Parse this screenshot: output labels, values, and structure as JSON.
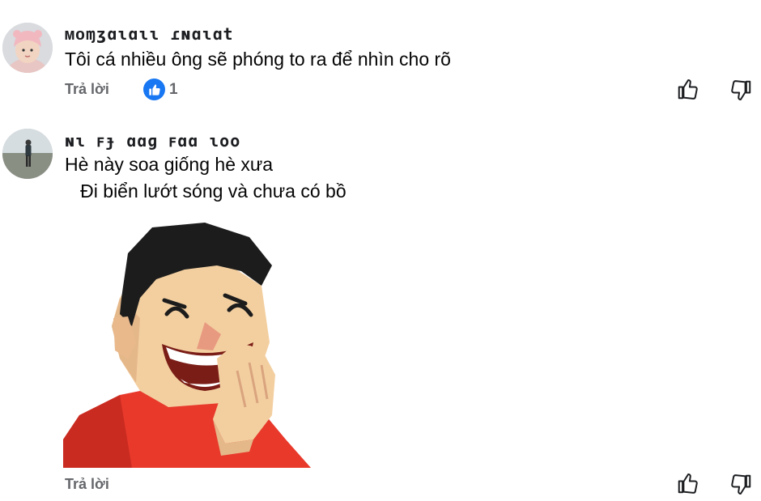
{
  "comments": [
    {
      "author": "ᴍᴏɱʒɑɩɑɩɩ ɾɴɑɩɑt",
      "text": "Tôi cá nhiều ông sẽ phóng to ra để nhìn cho rõ",
      "reply_label": "Trả lời",
      "like_count": "1",
      "avatar_icon": "girl-pink-hat-avatar",
      "reaction_icon": "thumbs-up-icon"
    },
    {
      "author": "ɴɩ  ꜰɟ  ɑɑɡ ꜰɑɑ ɩoo",
      "text_lines": [
        "Hè này soa giống hè xưa",
        "   Đi biển lướt sóng và chưa có bồ"
      ],
      "reply_label": "Trả lời",
      "avatar_icon": "man-outdoor-avatar",
      "sticker": "laughing-man-sticker"
    }
  ],
  "icons": {
    "like": "thumb-up-outline-icon",
    "dislike": "thumb-down-outline-icon"
  },
  "colors": {
    "like_badge": "#1877f2",
    "secondary_text": "#65676b"
  }
}
